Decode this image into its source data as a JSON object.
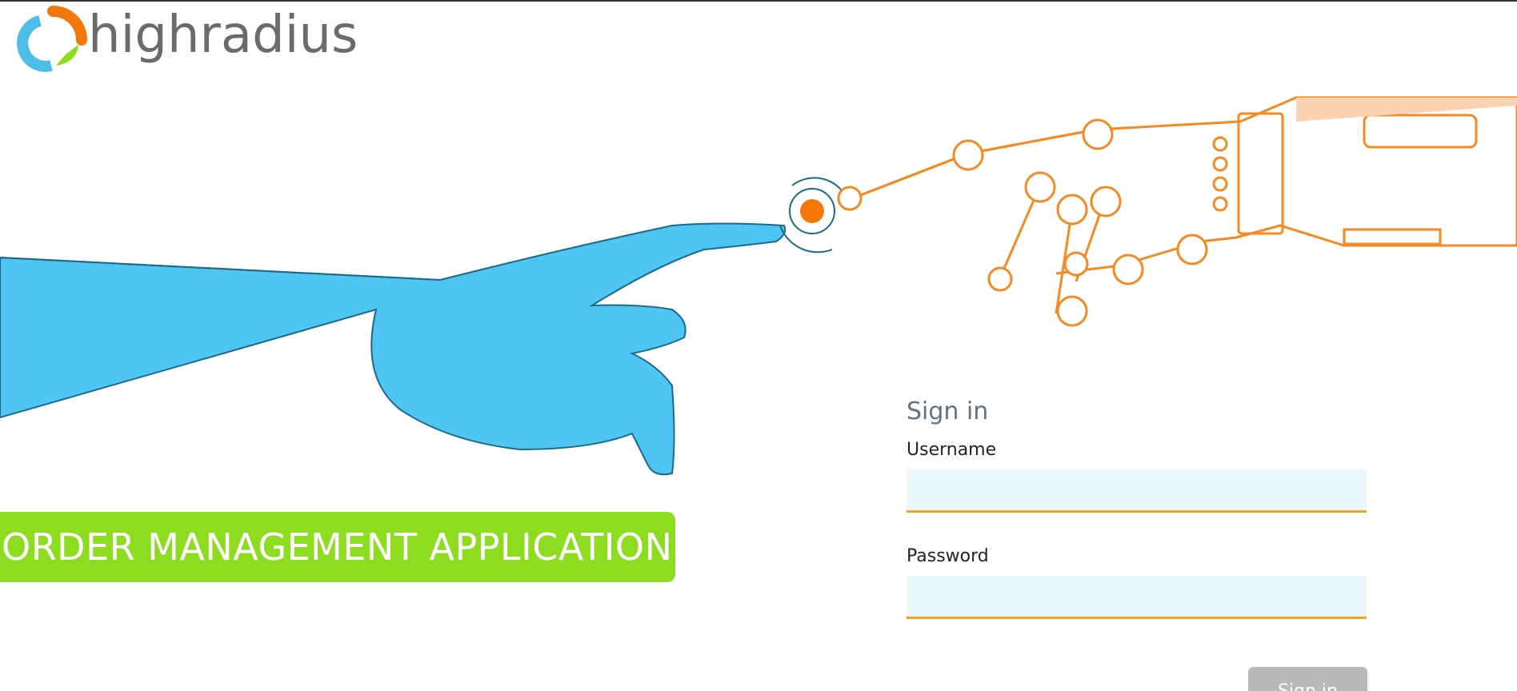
{
  "brand": {
    "name": "highradius",
    "logo_icon": "highradius-logo-icon",
    "colors": {
      "orange": "#f4770c",
      "blue": "#4bbde8",
      "green": "#8ddc1f",
      "gray": "#6b6b6b"
    }
  },
  "hero": {
    "app_title": "ORDER MANAGEMENT APPLICATION",
    "illustration": "human-hand-touching-robot-hand"
  },
  "signin": {
    "title": "Sign in",
    "username_label": "Username",
    "username_value": "",
    "password_label": "Password",
    "password_value": "",
    "button_label": "Sign in"
  },
  "colors": {
    "input_bg": "#eaf7fd",
    "input_border": "#f5a41a",
    "button_bg": "#b9b9b9"
  }
}
